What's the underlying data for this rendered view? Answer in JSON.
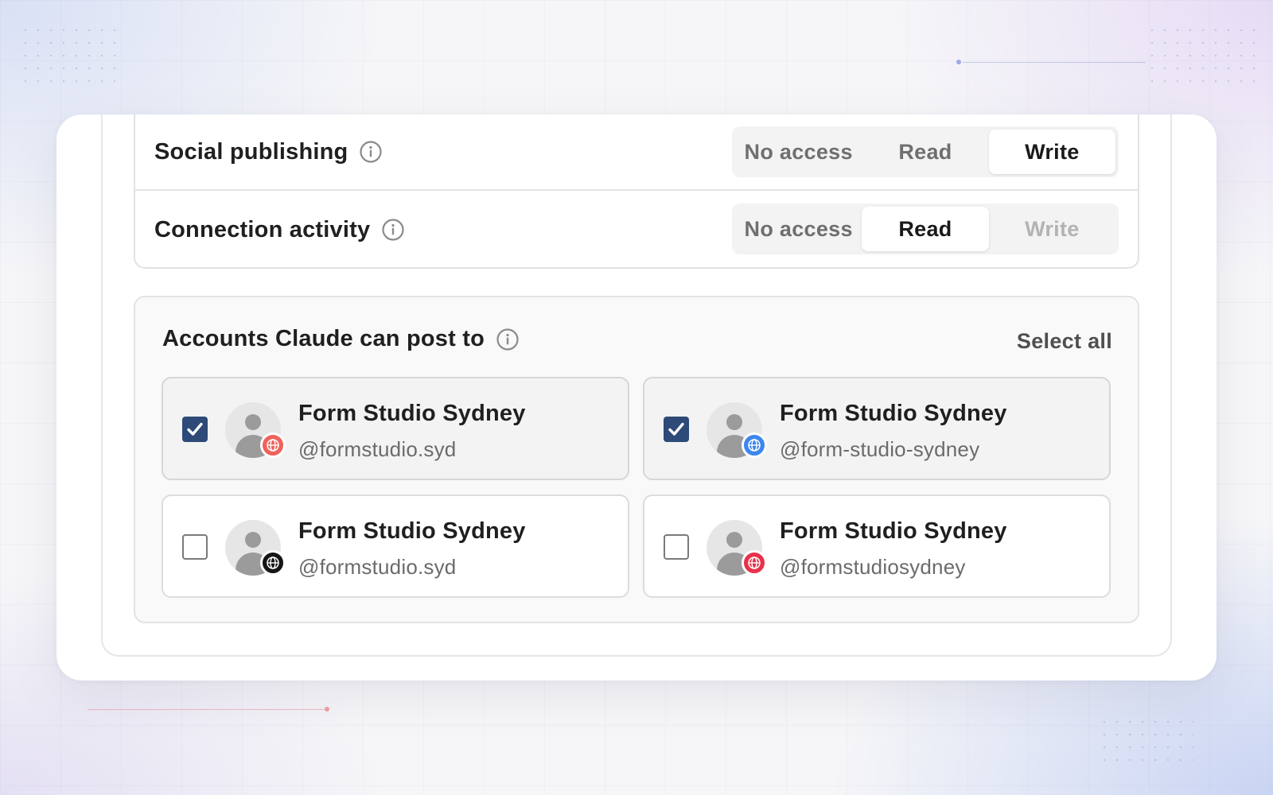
{
  "permissions": {
    "rows": [
      {
        "label": "Social publishing",
        "options": [
          "No access",
          "Read",
          "Write"
        ],
        "selected": "Write"
      },
      {
        "label": "Connection activity",
        "options": [
          "No access",
          "Read",
          "Write"
        ],
        "selected": "Read"
      }
    ]
  },
  "accounts": {
    "title": "Accounts Claude can post to",
    "select_all_label": "Select all",
    "items": [
      {
        "name": "Form Studio Sydney",
        "handle": "@formstudio.syd",
        "checked": true,
        "badge_icon": "globe-icon",
        "badge_color": "#f0615a"
      },
      {
        "name": "Form Studio Sydney",
        "handle": "@form-studio-sydney",
        "checked": true,
        "badge_icon": "globe-icon",
        "badge_color": "#3d86f0"
      },
      {
        "name": "Form Studio Sydney",
        "handle": "@formstudio.syd",
        "checked": false,
        "badge_icon": "globe-icon",
        "badge_color": "#161616"
      },
      {
        "name": "Form Studio Sydney",
        "handle": "@formstudiosydney",
        "checked": false,
        "badge_icon": "globe-icon",
        "badge_color": "#e6324b"
      }
    ]
  },
  "colors": {
    "checkbox_checked": "#2d4a78",
    "text_primary": "#1f1f1f",
    "text_secondary": "#6b6b6b"
  }
}
